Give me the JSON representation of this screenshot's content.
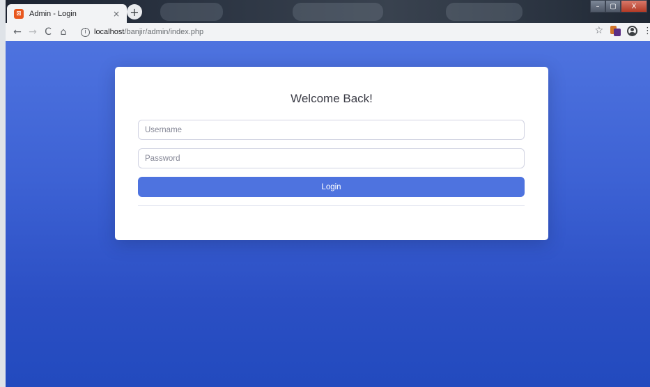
{
  "browser": {
    "tab_title": "Admin - Login",
    "tab_close_glyph": "×",
    "new_tab_glyph": "+",
    "favicon_glyph": "⊠",
    "window_controls": {
      "minimize": "–",
      "maximize": "▢",
      "close": "X"
    },
    "nav": {
      "back": "←",
      "forward": "→",
      "reload": "C",
      "home": "⌂"
    },
    "address": {
      "info_glyph": "i",
      "host": "localhost",
      "path": "/banjir/admin/index.php"
    },
    "bookmark_glyph": "☆",
    "menu_glyph": "⋮",
    "icons": {
      "favicon": "xampp-favicon-icon",
      "extension": "extension-icon",
      "profile": "profile-icon"
    }
  },
  "login": {
    "title": "Welcome Back!",
    "username_placeholder": "Username",
    "username_value": "",
    "password_placeholder": "Password",
    "password_value": "",
    "submit_label": "Login"
  },
  "colors": {
    "primary": "#4e73df",
    "background_top": "#4e73df",
    "background_bottom": "#224abe",
    "card": "#ffffff",
    "input_border": "#d1d3e2",
    "placeholder": "#858796"
  }
}
